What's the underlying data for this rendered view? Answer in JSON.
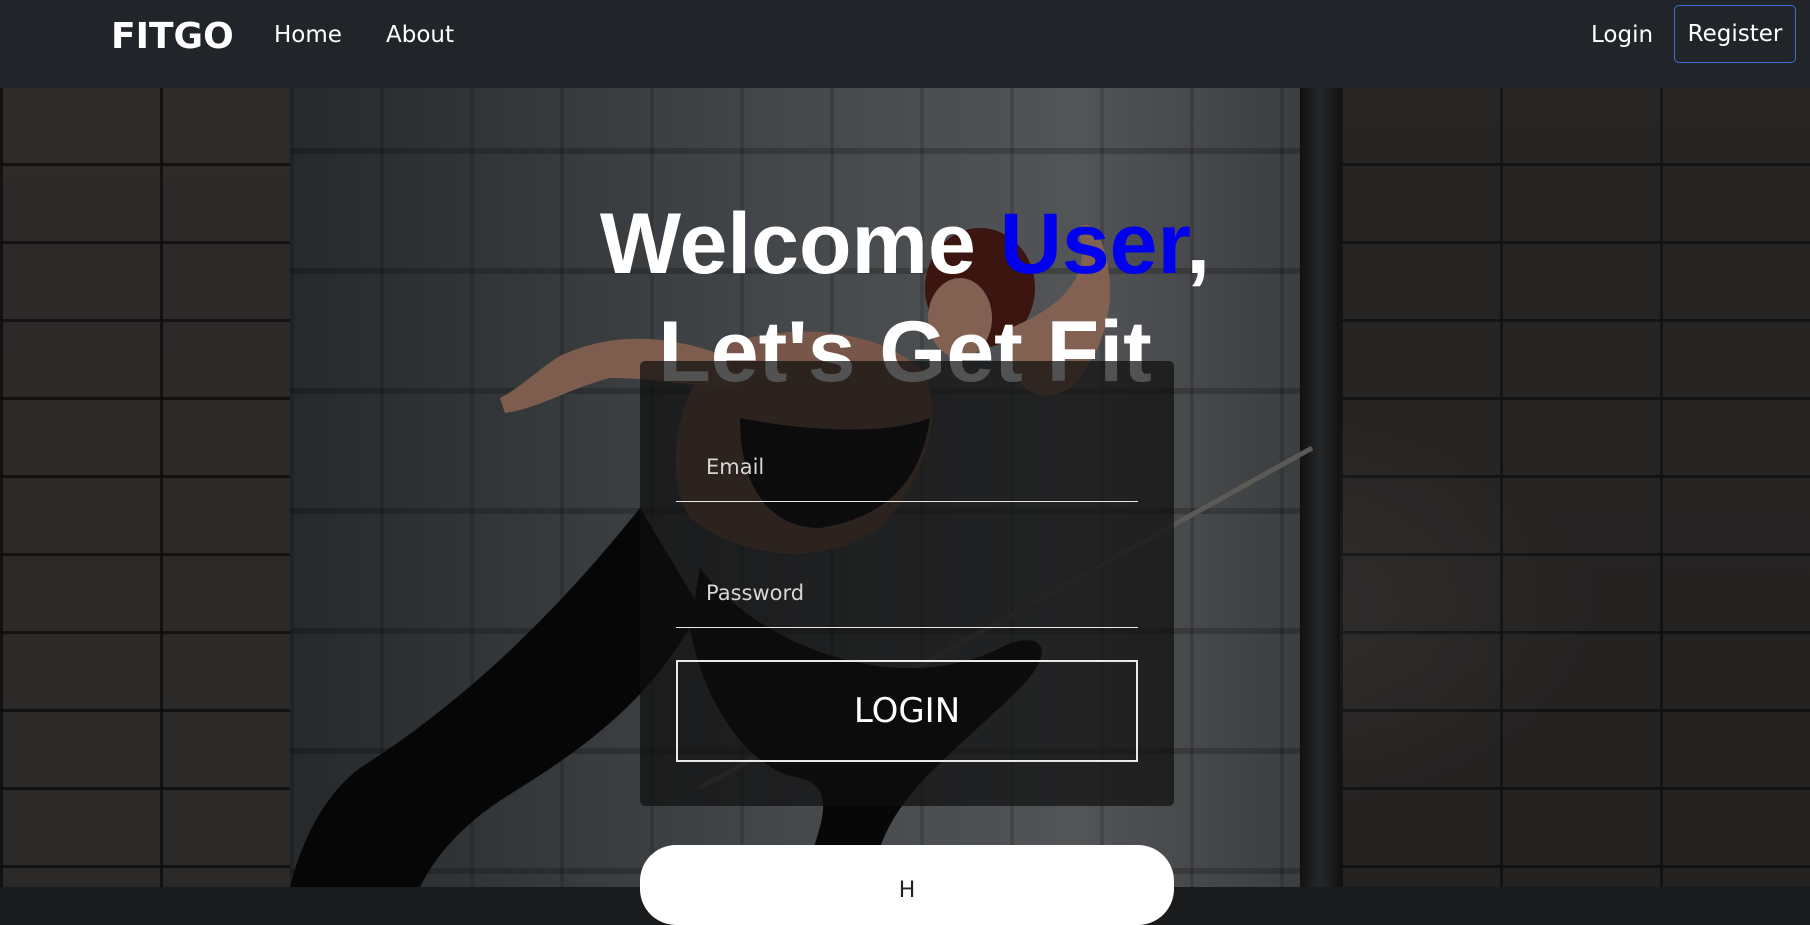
{
  "navbar": {
    "brand": "FITGO",
    "links": [
      {
        "label": "Home"
      },
      {
        "label": "About"
      }
    ],
    "login_label": "Login",
    "register_label": "Register"
  },
  "hero": {
    "headline_prefix": "Welcome ",
    "headline_highlight": "User",
    "headline_suffix": ",",
    "headline_line2": "Let's Get Fit",
    "highlight_color": "#0000ee"
  },
  "login_form": {
    "email_placeholder": "Email",
    "password_placeholder": "Password",
    "email_value": "",
    "password_value": "",
    "submit_label": "LOGIN"
  },
  "secondary_card": {
    "text": "H"
  },
  "colors": {
    "navbar_bg": "#212529",
    "register_border": "#3a6fd1"
  }
}
